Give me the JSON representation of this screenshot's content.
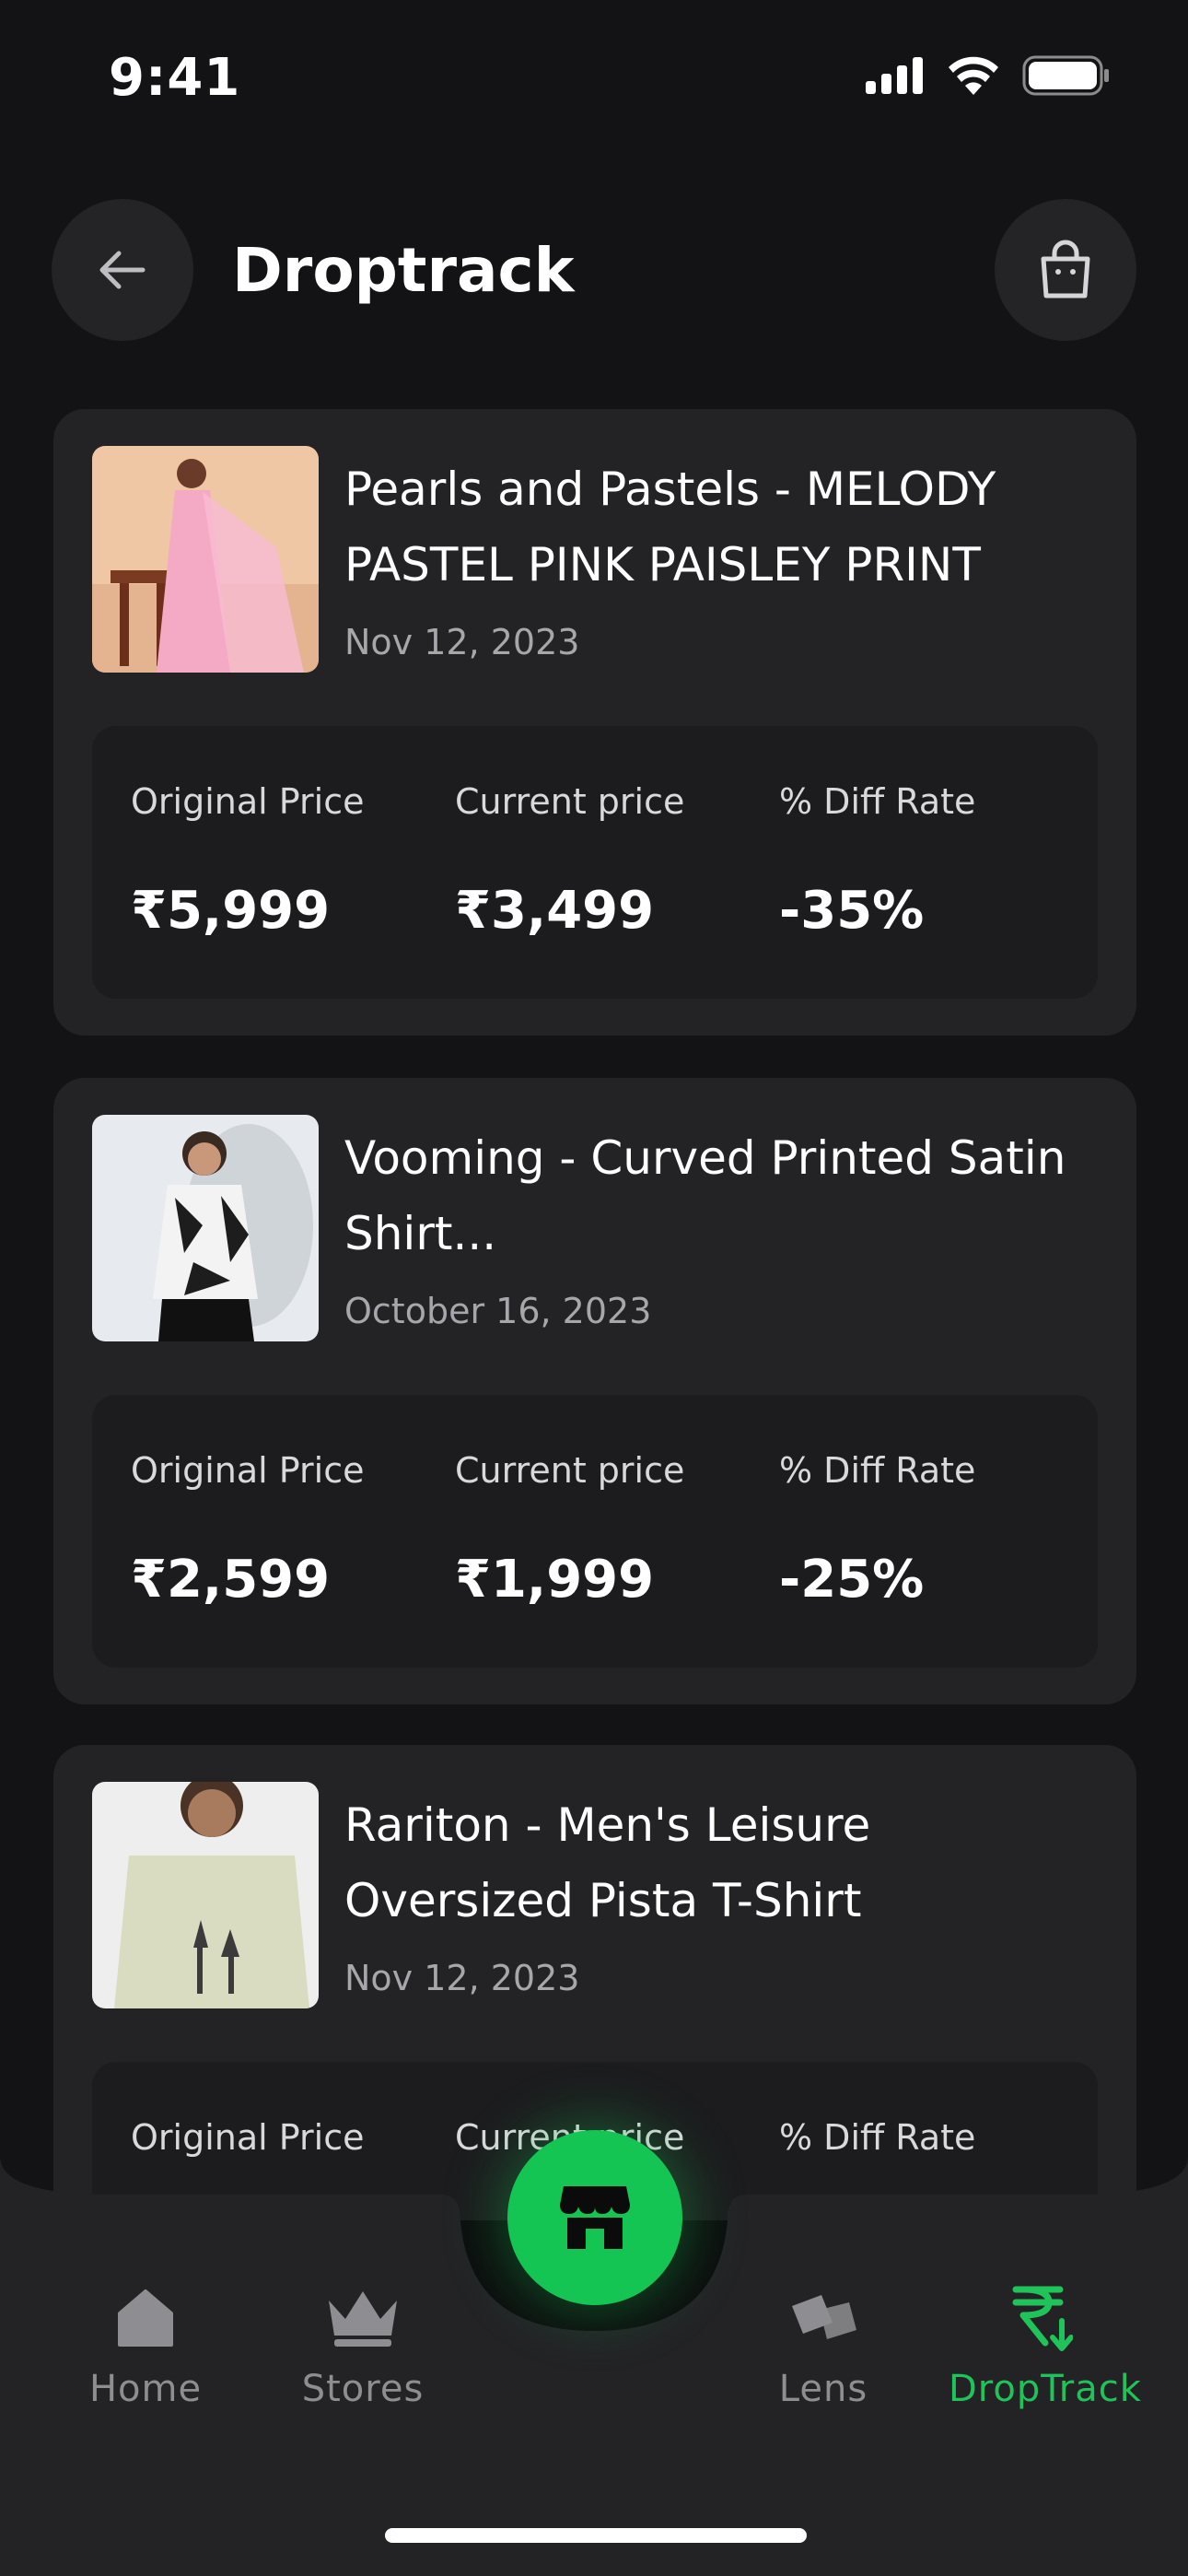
{
  "status_bar": {
    "time": "9:41"
  },
  "header": {
    "title": "Droptrack"
  },
  "products": [
    {
      "title": "Pearls and Pastels - MELODY PASTEL PINK PAISLEY PRINT CO...",
      "date": "Nov 12, 2023",
      "original_label": "Original Price",
      "original_price": "₹5,999",
      "current_label": "Current price",
      "current_price": "₹3,499",
      "diff_label": "% Diff Rate",
      "diff_rate": "-35%"
    },
    {
      "title": "Vooming - Curved Printed Satin Shirt...",
      "date": "October 16, 2023",
      "original_label": "Original Price",
      "original_price": "₹2,599",
      "current_label": "Current price",
      "current_price": "₹1,999",
      "diff_label": "% Diff Rate",
      "diff_rate": "-25%"
    },
    {
      "title": "Rariton - Men's Leisure Oversized Pista T-Shirt",
      "date": "Nov 12, 2023",
      "original_label": "Original Price",
      "current_label": "Current price",
      "diff_label": "% Diff Rate"
    }
  ],
  "nav": {
    "items": [
      {
        "label": "Home",
        "icon": "home-icon"
      },
      {
        "label": "Stores",
        "icon": "crown-icon"
      },
      {
        "label": "Lens",
        "icon": "lens-icon"
      },
      {
        "label": "DropTrack",
        "icon": "rupee-drop-icon",
        "active": true
      }
    ],
    "fab_icon": "store-icon"
  },
  "colors": {
    "accent": "#1fc35a",
    "background": "#131315",
    "card": "#232326",
    "price_box": "#1c1c1e"
  }
}
